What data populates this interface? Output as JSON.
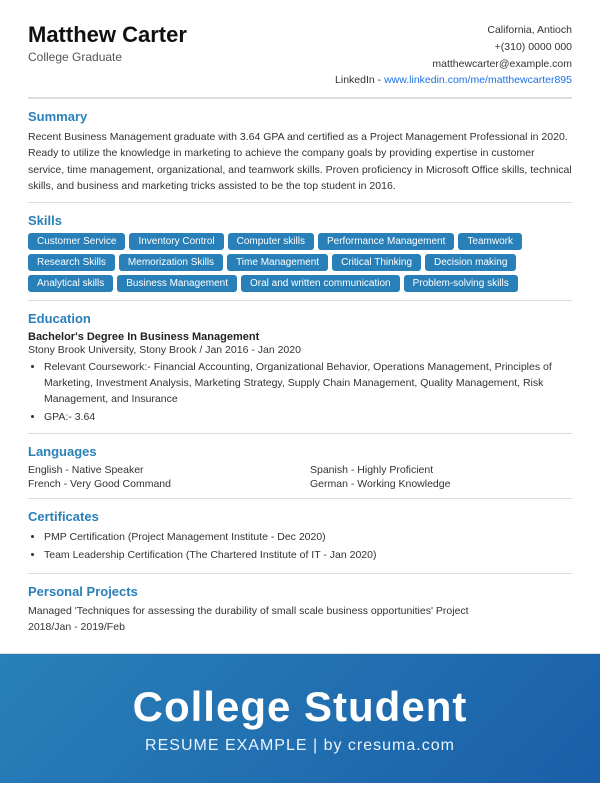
{
  "header": {
    "name": "Matthew Carter",
    "title": "College Graduate",
    "location": "California, Antioch",
    "phone": "+(310) 0000 000",
    "email": "matthewcarter@example.com",
    "linkedin_label": "LinkedIn",
    "linkedin_separator": " - ",
    "linkedin_url": "www.linkedin.com/me/matthewcarter895"
  },
  "summary": {
    "section_title": "Summary",
    "text": "Recent Business Management graduate with 3.64 GPA and certified as a Project Management Professional in 2020. Ready to utilize the knowledge in marketing to achieve the company goals by providing expertise in customer service, time management, organizational, and teamwork skills. Proven proficiency in Microsoft Office skills, technical skills, and business and marketing tricks assisted to be the top student in 2016."
  },
  "skills": {
    "section_title": "Skills",
    "items": [
      "Customer Service",
      "Inventory Control",
      "Computer skills",
      "Performance Management",
      "Teamwork",
      "Research Skills",
      "Memorization Skills",
      "Time Management",
      "Critical Thinking",
      "Decision making",
      "Analytical skills",
      "Business Management",
      "Oral and written communication",
      "Problem-solving skills"
    ]
  },
  "education": {
    "section_title": "Education",
    "degree": "Bachelor's Degree In Business Management",
    "school": "Stony Brook University, Stony Brook / Jan 2016 - Jan 2020",
    "bullets": [
      "Relevant Coursework:- Financial Accounting, Organizational Behavior, Operations Management, Principles of Marketing, Investment Analysis, Marketing Strategy, Supply Chain Management, Quality Management, Risk Management, and Insurance",
      "GPA:- 3.64"
    ]
  },
  "languages": {
    "section_title": "Languages",
    "items": [
      {
        "lang": "English",
        "level": "Native Speaker"
      },
      {
        "lang": "Spanish",
        "level": "Highly Proficient"
      },
      {
        "lang": "French",
        "level": "Very Good Command"
      },
      {
        "lang": "German",
        "level": "Working Knowledge"
      }
    ]
  },
  "certificates": {
    "section_title": "Certificates",
    "items": [
      "PMP Certification  (Project Management Institute  -  Dec 2020)",
      "Team Leadership Certification  (The Chartered Institute of IT  -  Jan 2020)"
    ]
  },
  "projects": {
    "section_title": "Personal Projects",
    "text": "Managed 'Techniques for assessing the durability of small scale business opportunities' Project",
    "date": "2018/Jan  -  2019/Feb"
  },
  "footer": {
    "big_title": "College Student",
    "sub_line": "RESUME EXAMPLE | by cresuma.com"
  }
}
